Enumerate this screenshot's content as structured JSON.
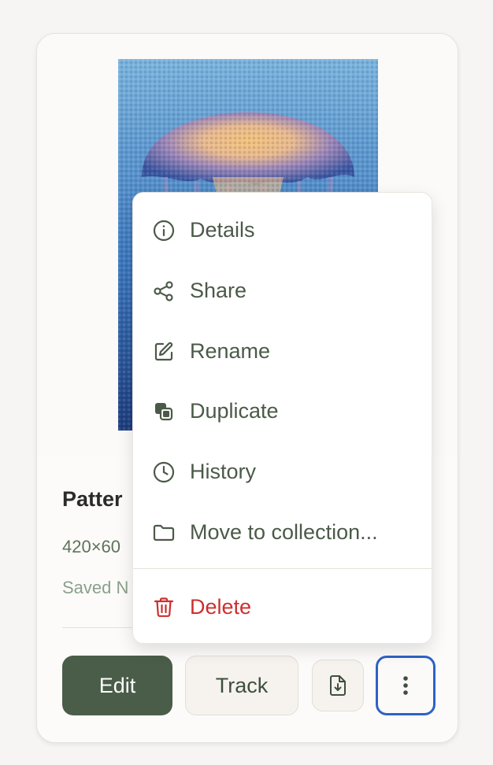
{
  "card": {
    "title": "Patter",
    "dimensions": "420×60",
    "saved": "Saved N"
  },
  "actions": {
    "edit_label": "Edit",
    "track_label": "Track",
    "download_icon": "file-download-icon",
    "more_icon": "more-vertical-icon"
  },
  "menu": {
    "items": [
      {
        "label": "Details",
        "icon": "info-icon"
      },
      {
        "label": "Share",
        "icon": "share-icon"
      },
      {
        "label": "Rename",
        "icon": "edit-icon"
      },
      {
        "label": "Duplicate",
        "icon": "duplicate-icon"
      },
      {
        "label": "History",
        "icon": "clock-icon"
      },
      {
        "label": "Move to collection...",
        "icon": "folder-icon"
      },
      {
        "label": "Delete",
        "icon": "trash-icon",
        "danger": true
      }
    ]
  },
  "colors": {
    "accent_green": "#4a5d48",
    "danger_red": "#cc2f2f",
    "focus_blue": "#2f62c4"
  }
}
